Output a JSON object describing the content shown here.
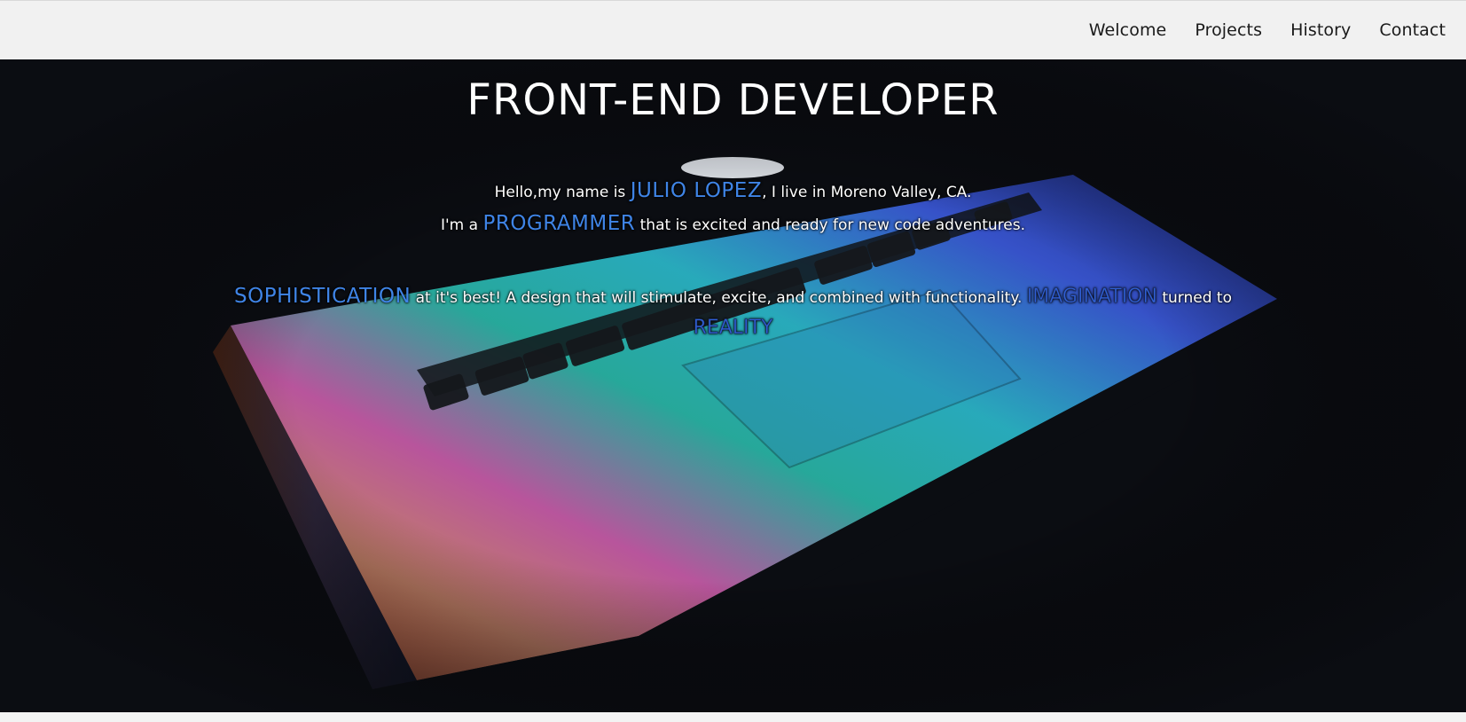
{
  "nav": {
    "links": [
      "Welcome",
      "Projects",
      "History",
      "Contact"
    ]
  },
  "hero": {
    "title": "FRONT-END DEVELOPER",
    "intro": {
      "prefix": "Hello,my name is ",
      "name": "JULIO LOPEZ",
      "suffix": ", I live in Moreno Valley, CA."
    },
    "role": {
      "prefix": "I'm a ",
      "highlight": "PROGRAMMER",
      "suffix": " that is excited and ready for new code adventures."
    },
    "tagline": {
      "word1": "SOPHISTICATION",
      "middle": " at it's best! A design that will stimulate, excite, and combined with functionality. ",
      "word2": "IMAGINATION",
      "after": " turned to",
      "word3": "REALITY"
    }
  },
  "colors": {
    "nav_bg": "#f1f1f1",
    "hero_bg": "#0b0d12",
    "highlight": "#3f84e6",
    "text": "#ffffff"
  }
}
